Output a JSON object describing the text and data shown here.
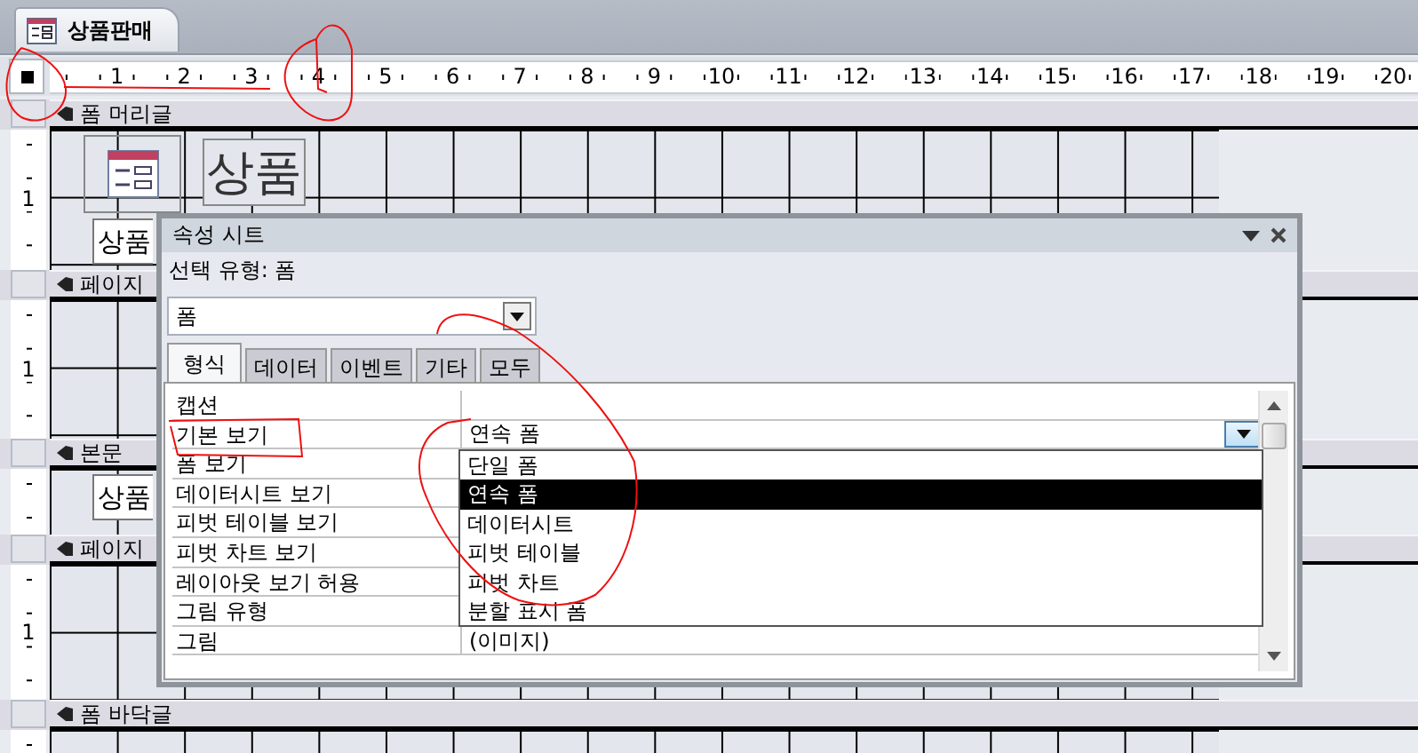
{
  "document_tab": {
    "title": "상품판매",
    "selected": true
  },
  "ruler": {
    "numbers": [
      "1",
      "2",
      "3",
      "4",
      "5",
      "6",
      "7",
      "8",
      "9",
      "10",
      "11",
      "12",
      "13",
      "14",
      "15",
      "16",
      "17",
      "18",
      "19",
      "20"
    ]
  },
  "sections": [
    {
      "title": "폼 머리글",
      "ruler_numbers": [
        "1"
      ],
      "controls": [
        {
          "kind": "logo"
        },
        {
          "kind": "title_label",
          "text": "상품"
        },
        {
          "kind": "label",
          "text": "상품"
        }
      ]
    },
    {
      "title": "페이지",
      "ruler_numbers": [
        "1"
      ]
    },
    {
      "title": "본문",
      "controls": [
        {
          "kind": "label",
          "text": "상품"
        }
      ]
    },
    {
      "title": "페이지",
      "ruler_numbers": [
        "1"
      ]
    },
    {
      "title": "폼 바닥글"
    }
  ],
  "property_sheet": {
    "title": "속성 시트",
    "selection_type": "선택 유형: 폼",
    "object_combo": {
      "value": "폼"
    },
    "tabs": [
      {
        "label": "형식",
        "selected": true
      },
      {
        "label": "데이터",
        "selected": false
      },
      {
        "label": "이벤트",
        "selected": false
      },
      {
        "label": "기타",
        "selected": false
      },
      {
        "label": "모두",
        "selected": false
      }
    ],
    "properties": [
      {
        "name": "캡션",
        "kind": "text"
      },
      {
        "name": "기본 보기",
        "kind": "dropdown",
        "value": "연속 폼"
      },
      {
        "name": "폼 보기",
        "kind": "text"
      },
      {
        "name": "데이터시트 보기",
        "kind": "text"
      },
      {
        "name": "피벗 테이블 보기",
        "kind": "text"
      },
      {
        "name": "피벗 차트 보기",
        "kind": "text"
      },
      {
        "name": "레이아웃 보기 허용",
        "kind": "text"
      },
      {
        "name": "그림 유형",
        "kind": "text"
      },
      {
        "name": "그림",
        "kind": "text",
        "value": "(이미지)"
      }
    ],
    "dropdown_options": [
      {
        "label": "단일 폼",
        "selected": false
      },
      {
        "label": "연속 폼",
        "selected": true
      },
      {
        "label": "데이터시트",
        "selected": false
      },
      {
        "label": "피벗 테이블",
        "selected": false
      },
      {
        "label": "피벗 차트",
        "selected": false
      },
      {
        "label": "분할 표시 폼",
        "selected": false
      }
    ]
  }
}
